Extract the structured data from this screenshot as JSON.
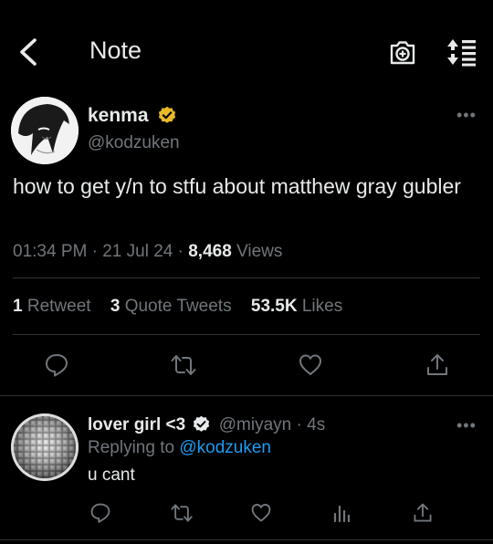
{
  "header": {
    "title": "Note"
  },
  "tweet": {
    "author_name": "kenma",
    "author_handle": "@kodzuken",
    "text": "how to get y/n to stfu about matthew gray gubler",
    "time": "01:34 PM",
    "date": "21 Jul 24",
    "views_count": "8,468",
    "views_label": "Views",
    "retweets_count": "1",
    "retweets_label": "Retweet",
    "quotes_count": "3",
    "quotes_label": "Quote Tweets",
    "likes_count": "53.5K",
    "likes_label": "Likes"
  },
  "reply": {
    "author_name": "lover girl <3",
    "author_handle": "@miyayn",
    "age": "4s",
    "replying_prefix": "Replying to",
    "replying_handle": "@kodzuken",
    "text": "u cant"
  },
  "colors": {
    "accent": "#1d9bf0",
    "badge": "#e8b829",
    "muted": "#71767b",
    "divider": "#2f3336"
  }
}
